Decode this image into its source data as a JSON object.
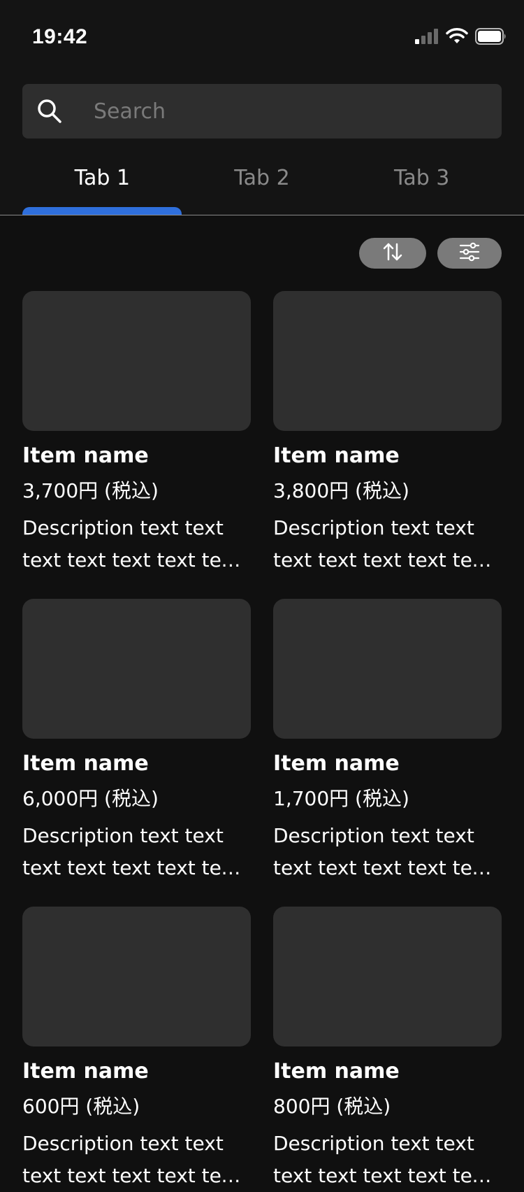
{
  "status_bar": {
    "time": "19:42",
    "icons": [
      "cellular-signal-icon",
      "wifi-icon",
      "battery-icon"
    ]
  },
  "search": {
    "placeholder": "Search",
    "value": "",
    "icon": "search-icon"
  },
  "tabs": [
    {
      "label": "Tab 1",
      "active": true
    },
    {
      "label": "Tab 2",
      "active": false
    },
    {
      "label": "Tab 3",
      "active": false
    }
  ],
  "toolbar": {
    "sort_icon": "sort-icon",
    "filter_icon": "filter-icon"
  },
  "colors": {
    "background": "#101010",
    "header": "#141414",
    "accent": "#2f6fdc",
    "card_placeholder": "#2f2f2f",
    "inactive_text": "#8a8a8a"
  },
  "items": [
    {
      "name": "Item name",
      "price": "3,700円 (税込)",
      "description": "Description text text text text text text text text text"
    },
    {
      "name": "Item name",
      "price": "3,800円 (税込)",
      "description": "Description text text text text text text text text text"
    },
    {
      "name": "Item name",
      "price": "6,000円 (税込)",
      "description": "Description text text text text text text text text text"
    },
    {
      "name": "Item name",
      "price": "1,700円 (税込)",
      "description": "Description text text text text text text text text text"
    },
    {
      "name": "Item name",
      "price": "600円 (税込)",
      "description": "Description text text text text text text text text text"
    },
    {
      "name": "Item name",
      "price": "800円 (税込)",
      "description": "Description text text text text text text text text text"
    }
  ]
}
